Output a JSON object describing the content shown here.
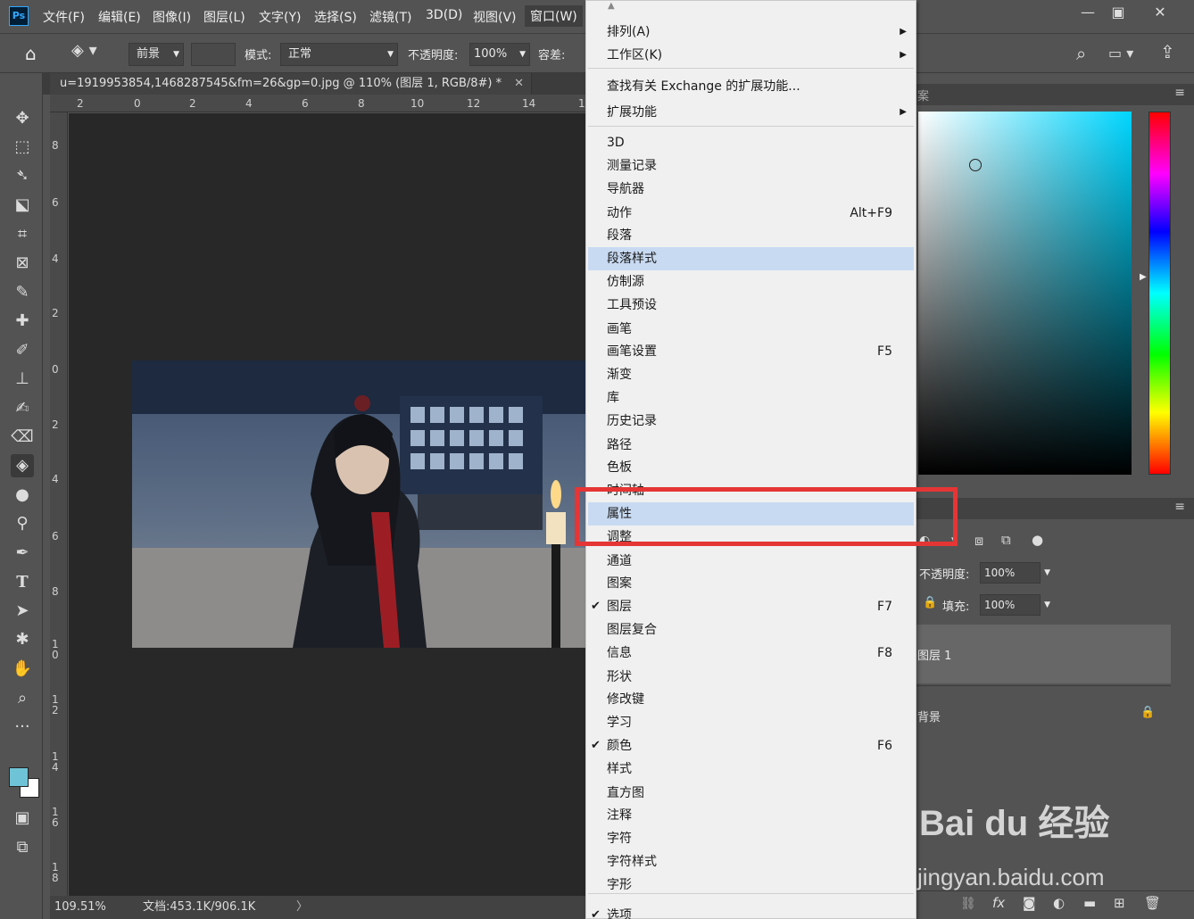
{
  "app": {
    "logo": "Ps",
    "menus": [
      "文件(F)",
      "编辑(E)",
      "图像(I)",
      "图层(L)",
      "文字(Y)",
      "选择(S)",
      "滤镜(T)",
      "3D(D)",
      "视图(V)",
      "窗口(W)"
    ]
  },
  "options": {
    "fill_source": "前景",
    "mode_label": "模式:",
    "mode_value": "正常",
    "opacity_label": "不透明度:",
    "opacity_value": "100%",
    "tolerance_label": "容差:"
  },
  "document": {
    "tab_title": "u=1919953854,1468287545&fm=26&gp=0.jpg @ 110% (图层 1, RGB/8#) *",
    "zoom": "109.51%",
    "doc_size": "文档:453.1K/906.1K",
    "h_ruler": [
      "2",
      "0",
      "2",
      "4",
      "6",
      "8",
      "10",
      "12",
      "14",
      "1"
    ],
    "v_ruler": [
      "8",
      "6",
      "4",
      "2",
      "0",
      "2",
      "4",
      "6",
      "8",
      "1\n0",
      "1\n2",
      "1\n4",
      "1\n6",
      "1\n8"
    ]
  },
  "window_menu": {
    "items": [
      {
        "label": "排列(A)",
        "submenu": true
      },
      {
        "label": "工作区(K)",
        "submenu": true
      },
      {
        "label": "查找有关 Exchange 的扩展功能..."
      },
      {
        "label": "扩展功能",
        "submenu": true
      },
      {
        "label": "3D"
      },
      {
        "label": "测量记录"
      },
      {
        "label": "导航器"
      },
      {
        "label": "动作",
        "shortcut": "Alt+F9"
      },
      {
        "label": "段落"
      },
      {
        "label": "段落样式",
        "highlight": true
      },
      {
        "label": "仿制源"
      },
      {
        "label": "工具预设"
      },
      {
        "label": "画笔"
      },
      {
        "label": "画笔设置",
        "shortcut": "F5"
      },
      {
        "label": "渐变"
      },
      {
        "label": "库"
      },
      {
        "label": "历史记录"
      },
      {
        "label": "路径"
      },
      {
        "label": "色板"
      },
      {
        "label": "时间轴"
      },
      {
        "label": "属性",
        "highlight": true
      },
      {
        "label": "调整"
      },
      {
        "label": "通道"
      },
      {
        "label": "图案"
      },
      {
        "label": "图层",
        "shortcut": "F7",
        "checked": true
      },
      {
        "label": "图层复合"
      },
      {
        "label": "信息",
        "shortcut": "F8"
      },
      {
        "label": "形状"
      },
      {
        "label": "修改键"
      },
      {
        "label": "学习"
      },
      {
        "label": "颜色",
        "shortcut": "F6",
        "checked": true
      },
      {
        "label": "样式"
      },
      {
        "label": "直方图"
      },
      {
        "label": "注释"
      },
      {
        "label": "字符"
      },
      {
        "label": "字符样式"
      },
      {
        "label": "字形"
      },
      {
        "label": "选项",
        "checked": true
      }
    ]
  },
  "layers_panel": {
    "opacity_label": "不透明度:",
    "opacity_value": "100%",
    "fill_label": "填充:",
    "fill_value": "100%",
    "layers": [
      "图层 1",
      "背景"
    ],
    "panel_tab_fragment": "案"
  },
  "watermark": {
    "logo": "Bai du 经验",
    "url": "jingyan.baidu.com"
  },
  "colors": {
    "highlight": "#c8daf2",
    "annotation_box": "#e53535",
    "foreground": "#6ec3d6"
  }
}
